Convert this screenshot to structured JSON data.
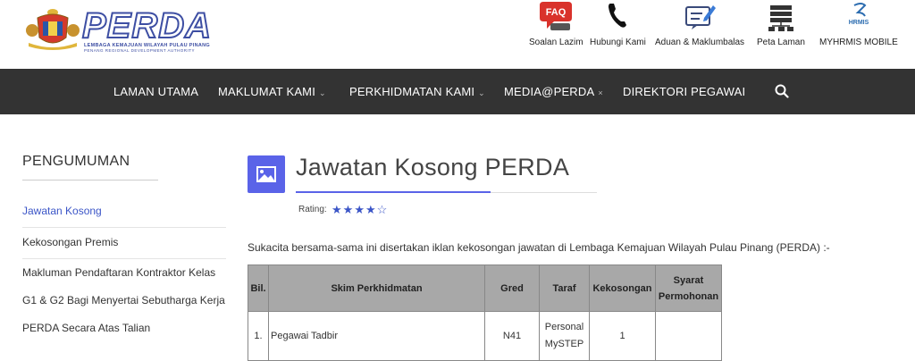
{
  "header": {
    "logo": {
      "wordmark": "PERDA",
      "line1": "LEMBAGA KEMAJUAN WILAYAH PULAU PINANG",
      "line2": "PENANG REGIONAL DEVELOPMENT AUTHORITY"
    },
    "quick_links": [
      {
        "label": "Soalan Lazim",
        "icon": "faq-icon",
        "badge": "FAQ"
      },
      {
        "label": "Hubungi Kami",
        "icon": "phone-icon"
      },
      {
        "label": "Aduan & Maklumbalas",
        "icon": "feedback-edit-icon"
      },
      {
        "label": "Peta Laman",
        "icon": "sitemap-icon"
      },
      {
        "label": "MYHRMIS MOBILE",
        "icon": "hrmis-logo-icon",
        "badge": "HRMIS"
      }
    ]
  },
  "nav": {
    "items": [
      {
        "label": "LAMAN UTAMA",
        "caret": ""
      },
      {
        "label": "MAKLUMAT KAMI",
        "caret": "⌄"
      },
      {
        "label": "PERKHIDMATAN KAMI",
        "caret": "⌄"
      },
      {
        "label": "MEDIA@PERDA",
        "caret": "×"
      },
      {
        "label": "DIREKTORI PEGAWAI",
        "caret": ""
      }
    ],
    "search_icon": "search-icon"
  },
  "sidebar": {
    "title": "PENGUMUMAN",
    "items": [
      {
        "label": "Jawatan Kosong",
        "active": true
      },
      {
        "label": "Kekosongan Premis",
        "active": false
      },
      {
        "label": "Makluman Pendaftaran Kontraktor Kelas G1 & G2 Bagi Menyertai Sebutharga Kerja PERDA Secara Atas Talian",
        "lines": [
          "Makluman Pendaftaran Kontraktor Kelas",
          "G1 & G2 Bagi Menyertai Sebutharga Kerja",
          "PERDA Secara Atas Talian"
        ],
        "active": false
      }
    ]
  },
  "main": {
    "icon": "image-icon",
    "title": "Jawatan Kosong PERDA",
    "rating_label": "Rating:",
    "rating_value": 4,
    "rating_max": 5,
    "intro": "Sukacita bersama-sama ini disertakan iklan kekosongan jawatan di Lembaga Kemajuan Wilayah Pulau Pinang (PERDA) :-",
    "table": {
      "headers": [
        "Bil.",
        "Skim Perkhidmatan",
        "Gred",
        "Taraf",
        "Kekosongan",
        "Syarat Permohonan"
      ],
      "header_syarat_lines": [
        "Syarat",
        "Permohonan"
      ],
      "rows": [
        {
          "bil": "1.",
          "skim": "Pegawai Tadbir",
          "gred": "N41",
          "taraf_lines": [
            "Personal",
            "MySTEP"
          ],
          "kekosongan": "1",
          "syarat": ""
        }
      ]
    }
  },
  "colors": {
    "accent": "#5a63e8",
    "link": "#3b55c7",
    "nav_bg": "#333333",
    "table_header": "#a8a8a8"
  }
}
